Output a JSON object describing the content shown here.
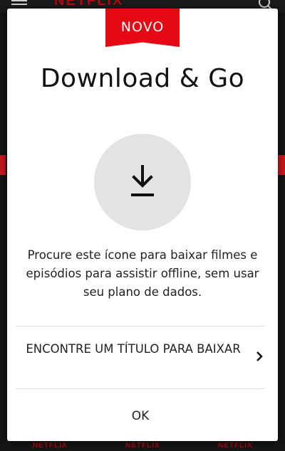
{
  "background": {
    "logo_text": "NETFLIX",
    "bottom_logos": [
      "NETFLIX",
      "NETFLIX",
      "NETFLIX"
    ]
  },
  "dialog": {
    "badge": "NOVO",
    "title": "Download & Go",
    "description": "Procure este ícone para baixar filmes e episódios para assistir offline, sem usar seu plano de dados.",
    "find_title_label": "ENCONTRE UM TÍTULO PARA BAIXAR",
    "ok_label": "OK"
  },
  "colors": {
    "accent": "#e50914",
    "icon_circle": "#e3e3e3"
  },
  "icons": {
    "download": "download-icon",
    "chevron": "chevron-right-icon",
    "menu": "menu-icon",
    "search": "search-icon"
  }
}
